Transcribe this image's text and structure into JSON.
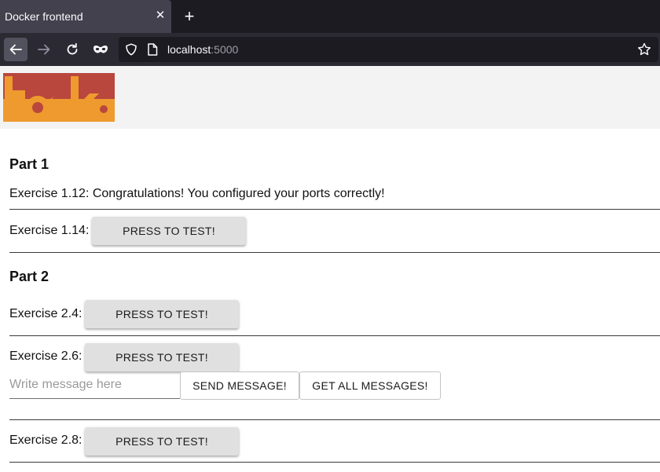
{
  "browser": {
    "tab_title": "Docker frontend",
    "url_host": "localhost",
    "url_port": ":5000"
  },
  "header": {
    "logo_text": "toska"
  },
  "part1": {
    "heading": "Part 1",
    "ex_1_12": "Exercise 1.12: Congratulations! You configured your ports correctly!",
    "ex_1_14_label": "Exercise 1.14:",
    "ex_1_14_button": "PRESS TO TEST!"
  },
  "part2": {
    "heading": "Part 2",
    "ex_2_4_label": "Exercise 2.4:",
    "ex_2_4_button": "PRESS TO TEST!",
    "ex_2_6_label": "Exercise 2.6:",
    "ex_2_6_button": "PRESS TO TEST!",
    "message_placeholder": "Write message here",
    "send_button": "SEND MESSAGE!",
    "get_all_button": "GET ALL MESSAGES!",
    "ex_2_8_label": "Exercise 2.8:",
    "ex_2_8_button": "PRESS TO TEST!"
  },
  "colors": {
    "logo_red": "#b9473d",
    "logo_orange": "#ee9a2e",
    "button_grey": "#e0e0e0"
  }
}
